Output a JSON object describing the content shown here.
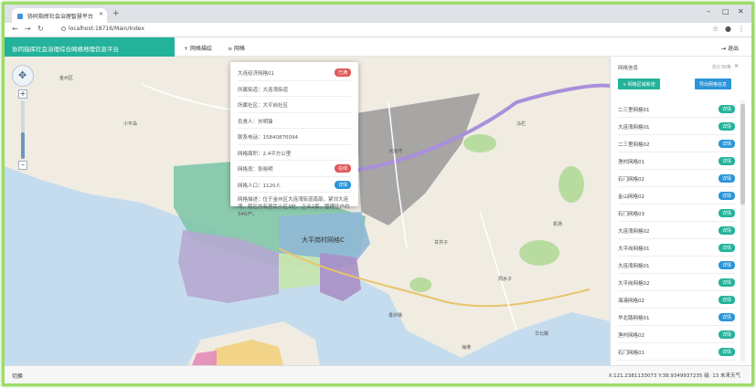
{
  "browser": {
    "tab_title": "协同指挥社会治理智慧平台",
    "url": "localhost:18716/Main/Index"
  },
  "app": {
    "title": "协同指挥社会治理综合网格地理信息平台",
    "menu": [
      {
        "icon": "plus-icon",
        "label": "网格描绘"
      },
      {
        "icon": "layers-icon",
        "label": "网格"
      }
    ],
    "logout_label": "退出"
  },
  "map": {
    "region_label": "大平岗村网格C",
    "place_labels": [
      "金州区",
      "小平岛",
      "大连湾",
      "甘井子",
      "马栏",
      "周水子",
      "机场",
      "香炉礁",
      "华北路",
      "海港"
    ],
    "colors": {
      "water": "#c5dcef",
      "land": "#f0ece2",
      "green": "#b8dca0",
      "grid_teal": "#7fc6a9",
      "grid_lavender": "#b5a8d0",
      "grid_blue": "#8fb8d6",
      "grid_purple": "#a88fc6",
      "gray_overlay": "#8f8f8f",
      "route": "#a98fdb"
    },
    "zoom_level": 0.45
  },
  "popup": {
    "rows": [
      {
        "text": "大连经济网格01",
        "badge": "已满",
        "badge_color": "#e05a5a"
      },
      {
        "text": "所属街道：大连湾街道",
        "badge": "",
        "badge_color": ""
      },
      {
        "text": "所属社区：大平岗社区",
        "badge": "",
        "badge_color": ""
      },
      {
        "text": "负责人：刘明锋",
        "badge": "",
        "badge_color": ""
      },
      {
        "text": "联系电话：15840876094",
        "badge": "",
        "badge_color": ""
      },
      {
        "text": "网格面积：2.4平方公里",
        "badge": "",
        "badge_color": ""
      },
      {
        "text": "网格员：张晓明",
        "badge": "在线",
        "badge_color": "#e05a5a"
      },
      {
        "text": "网格人口：1120人",
        "badge": "详情",
        "badge_color": "#2a95d8"
      },
      {
        "text": "网格描述：位于金州区大连湾街道南部，紧邻大连湾，辖区内有居民小区3处、企业2家，管理住户约340户。",
        "badge": "",
        "badge_color": ""
      }
    ]
  },
  "panel": {
    "title": "网格信息",
    "subtitle": "共计30条",
    "add_button": "+ 网格区域新增",
    "import_button": "导出网格信息",
    "items": [
      {
        "label": "二三里网格01",
        "badge": "详情",
        "badge_color": "#23b29a"
      },
      {
        "label": "大连湾网格01",
        "badge": "详情",
        "badge_color": "#23b29a"
      },
      {
        "label": "二三里网格02",
        "badge": "详情",
        "badge_color": "#2a95d8"
      },
      {
        "label": "渔村网格01",
        "badge": "详情",
        "badge_color": "#23b29a"
      },
      {
        "label": "石门网格02",
        "badge": "详情",
        "badge_color": "#2a95d8"
      },
      {
        "label": "金山网格02",
        "badge": "详情",
        "badge_color": "#2a95d8"
      },
      {
        "label": "石门网格03",
        "badge": "详情",
        "badge_color": "#23b29a"
      },
      {
        "label": "大连湾网格02",
        "badge": "详情",
        "badge_color": "#23b29a"
      },
      {
        "label": "大平岗网格01",
        "badge": "详情",
        "badge_color": "#23b29a"
      },
      {
        "label": "大连湾网格01",
        "badge": "详情",
        "badge_color": "#2a95d8"
      },
      {
        "label": "大平岗网格02",
        "badge": "详情",
        "badge_color": "#23b29a"
      },
      {
        "label": "海港网格02",
        "badge": "详情",
        "badge_color": "#23b29a"
      },
      {
        "label": "华北路网格01",
        "badge": "详情",
        "badge_color": "#2a95d8"
      },
      {
        "label": "渔村网格02",
        "badge": "详情",
        "badge_color": "#23b29a"
      },
      {
        "label": "石门网格01",
        "badge": "详情",
        "badge_color": "#23b29a"
      }
    ]
  },
  "status": {
    "left": "切换",
    "coords": "X:121.2381133073 Y:38.9349937235 级: 13 未来天气"
  }
}
